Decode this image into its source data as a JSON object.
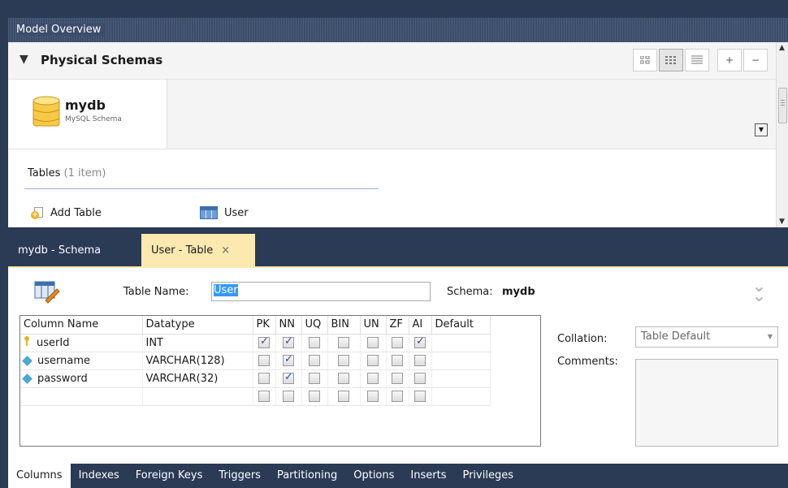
{
  "title_bar": {
    "label": "Model Overview"
  },
  "physical_schemas": {
    "title": "Physical Schemas",
    "view_buttons": [
      "small-icons",
      "grid-icons",
      "list",
      "add",
      "remove"
    ],
    "schema": {
      "name": "mydb",
      "subtitle": "MySQL Schema"
    },
    "tables_label": "Tables",
    "tables_count": "(1 item)",
    "items": [
      {
        "label": "Add Table",
        "icon": "add-table-icon"
      },
      {
        "label": "User",
        "icon": "table-icon"
      }
    ]
  },
  "editor_tabs": [
    {
      "label": "mydb - Schema",
      "active": false
    },
    {
      "label": "User - Table",
      "active": true,
      "close": "×"
    }
  ],
  "table_editor": {
    "table_name_label": "Table Name:",
    "table_name_value": "User",
    "schema_label": "Schema:",
    "schema_value": "mydb",
    "columns_header": [
      "Column Name",
      "Datatype",
      "PK",
      "NN",
      "UQ",
      "BIN",
      "UN",
      "ZF",
      "AI",
      "Default"
    ],
    "columns": [
      {
        "name": "userId",
        "icon": "primary-key-icon",
        "datatype": "INT",
        "flags": [
          true,
          true,
          false,
          false,
          false,
          false,
          true
        ]
      },
      {
        "name": "username",
        "icon": "column-diamond-icon",
        "datatype": "VARCHAR(128)",
        "flags": [
          false,
          true,
          false,
          false,
          false,
          false,
          false
        ]
      },
      {
        "name": "password",
        "icon": "column-diamond-icon",
        "datatype": "VARCHAR(32)",
        "flags": [
          false,
          true,
          false,
          false,
          false,
          false,
          false
        ]
      }
    ],
    "collation_label": "Collation:",
    "collation_value": "Table Default",
    "comments_label": "Comments:"
  },
  "bottom_tabs": [
    "Columns",
    "Indexes",
    "Foreign Keys",
    "Triggers",
    "Partitioning",
    "Options",
    "Inserts",
    "Privileges"
  ],
  "colors": {
    "frame": "#2b3a55",
    "active_tab": "#fbe9b0",
    "selection": "#3399ff"
  }
}
